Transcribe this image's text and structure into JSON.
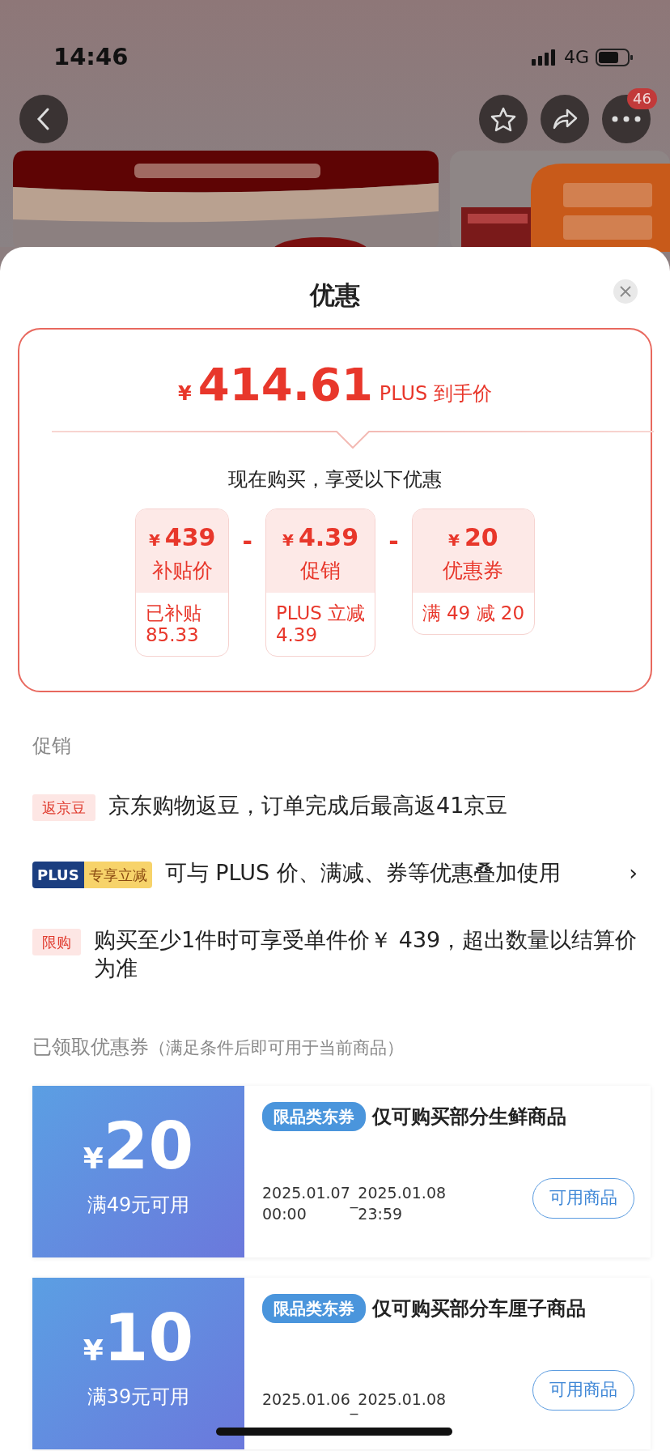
{
  "status_bar": {
    "time": "14:46",
    "network": "4G"
  },
  "nav": {
    "badge": "46"
  },
  "sheet": {
    "title": "优惠"
  },
  "price": {
    "currency": "¥",
    "amount": "414.61",
    "label": "PLUS 到手价"
  },
  "breakdown_title": "现在购买，享受以下优惠",
  "breakdown": [
    {
      "currency": "¥",
      "amount": "439",
      "label": "补贴价",
      "detail_lines": [
        "已补贴",
        "85.33"
      ]
    },
    {
      "operator": "-",
      "currency": "¥",
      "amount": "4.39",
      "label": "促销",
      "detail_lines": [
        "PLUS 立减",
        "4.39"
      ]
    },
    {
      "operator": "-",
      "currency": "¥",
      "amount": "20",
      "label": "优惠券",
      "detail_lines": [
        "满 49 减 20"
      ]
    }
  ],
  "promotions": {
    "title": "促销",
    "items": [
      {
        "kind": "tag",
        "tag": "返京豆",
        "text": "京东购物返豆，订单完成后最高返41京豆"
      },
      {
        "kind": "plus",
        "tag": "PLUS",
        "tag2": "专享立减",
        "text": "可与 PLUS 价、满减、券等优惠叠加使用",
        "arrow": "›"
      },
      {
        "kind": "tag",
        "tag": "限购",
        "text": "购买至少1件时可享受单件价￥ 439，超出数量以结算价为准"
      }
    ]
  },
  "coupons": {
    "title": "已领取优惠券",
    "note": "（满足条件后即可用于当前商品）",
    "items": [
      {
        "currency": "¥",
        "amount": "20",
        "condition": "满49元可用",
        "tag": "限品类东券",
        "title": "仅可购买部分生鲜商品",
        "start_date": "2025.01.07",
        "start_time": "00:00",
        "separator": "_",
        "end_date": "2025.01.08",
        "end_time": "23:59",
        "button": "可用商品"
      },
      {
        "currency": "¥",
        "amount": "10",
        "condition": "满39元可用",
        "tag": "限品类东券",
        "title": "仅可购买部分车厘子商品",
        "start_date": "2025.01.06",
        "separator": "_",
        "end_date": "2025.01.08",
        "button": "可用商品"
      }
    ]
  }
}
